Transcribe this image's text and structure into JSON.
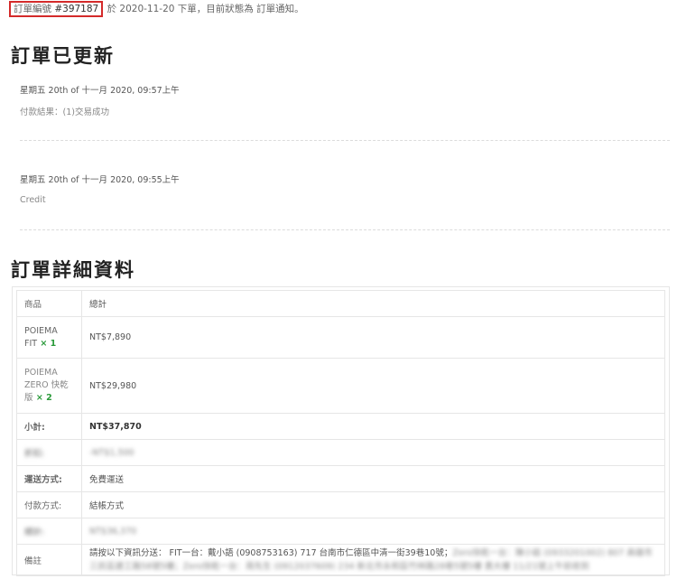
{
  "header": {
    "order_label": "訂單編號 ",
    "order_number": "#397187",
    "rest": " 於 2020-11-20 下單，目前狀態為 訂單通知。"
  },
  "updates": {
    "title": "訂單已更新",
    "notes": [
      {
        "date": "星期五 20th of 十一月 2020, 09:57上午",
        "body": "付款結果：(1)交易成功"
      },
      {
        "date": "星期五 20th of 十一月 2020, 09:55上午",
        "body": "Credit"
      }
    ]
  },
  "details": {
    "title": "訂單詳細資料",
    "col_product": "商品",
    "col_total": "總計",
    "items": [
      {
        "name_line1": "POIEMA",
        "name_line2": "FIT",
        "name_line3": "",
        "qty": " × 1",
        "total": "NT$7,890"
      },
      {
        "name_line1": "POIEMA",
        "name_line2": "ZERO 快乾",
        "name_line3": "版",
        "qty": " × 2",
        "total": "NT$29,980"
      }
    ],
    "subtotal_label": "小計:",
    "subtotal_value": "NT$37,870",
    "discount_label": "折扣:",
    "discount_value": "-NT$1,500",
    "shipping_label": "運送方式:",
    "shipping_value": "免費運送",
    "payment_label": "付款方式:",
    "payment_value": "結帳方式",
    "total_label": "總計:",
    "total_value": "NT$36,370",
    "remark_label": "備註",
    "remark_line1_clear": "請按以下資訊分送： FIT一台：戴小語 (0908753163) 717 台南市仁德區中清一街39巷10號；",
    "remark_line1_blur": "Zero快乾一台：陳小姐 (0933201002) 807 高雄市",
    "remark_line2_blur": "三民區建工路58號5樓；Zero快乾一台：周先生 (0912037609) 234 新北市永和區竹林路28巷5號5樓 貴大樓 11/21號上午前收到"
  }
}
